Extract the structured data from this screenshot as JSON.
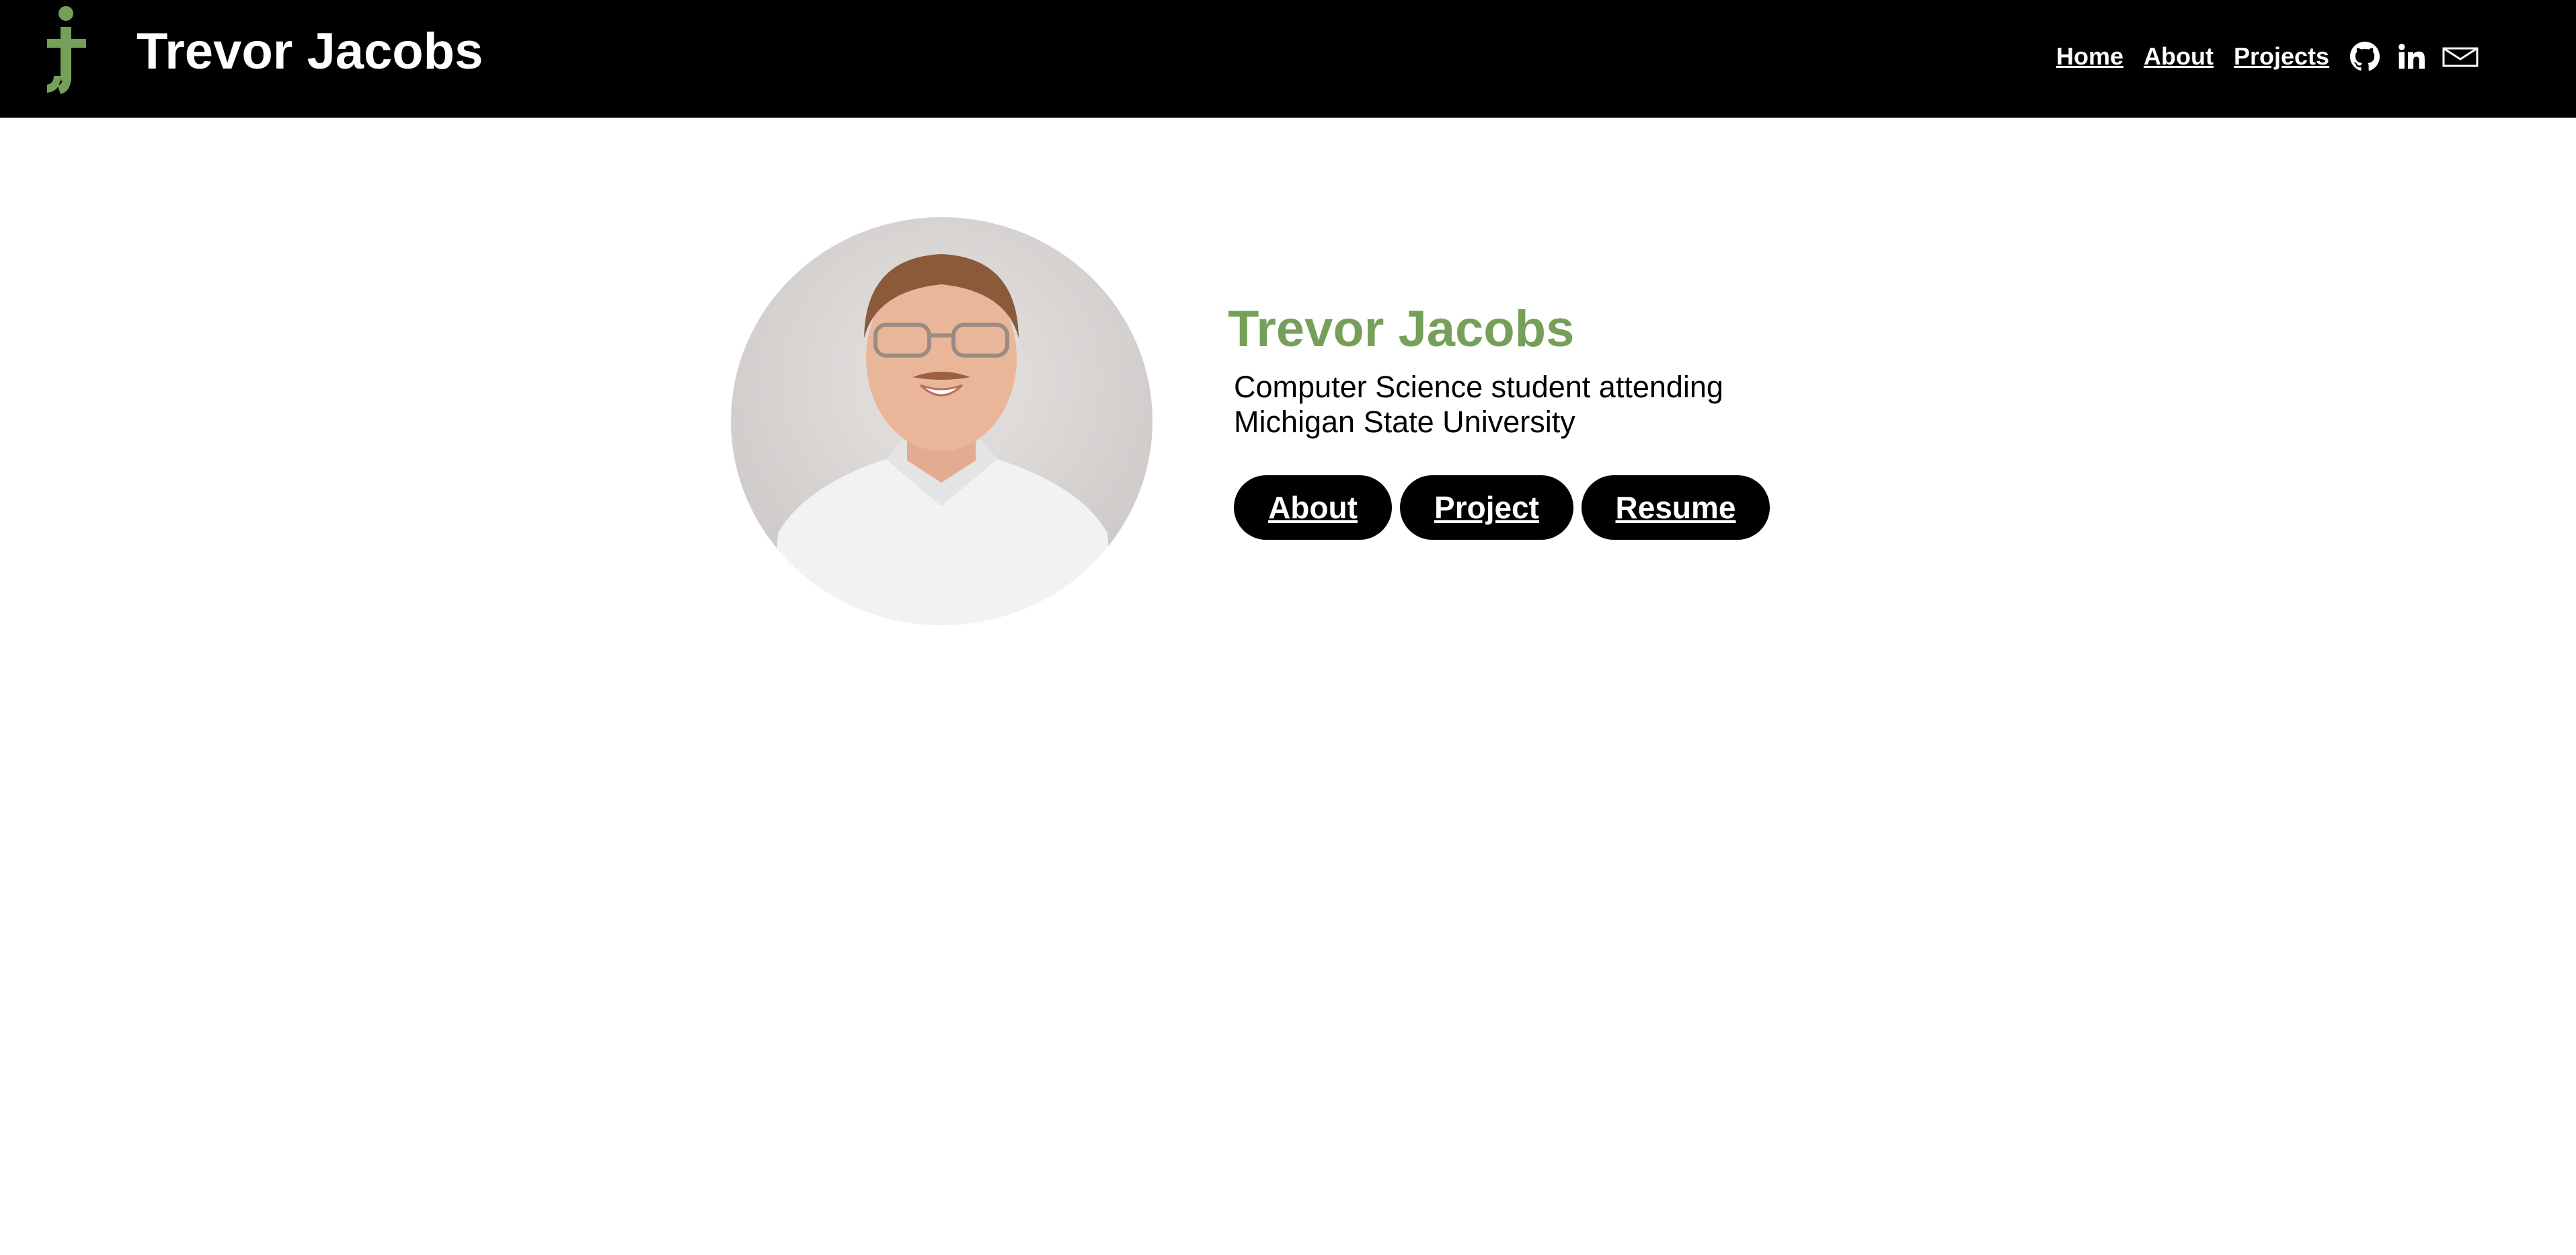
{
  "header": {
    "site_title": "Trevor Jacobs",
    "logo_icon": "tj-monogram-logo",
    "nav": {
      "home_label": "Home",
      "about_label": "About",
      "projects_label": "Projects"
    },
    "social_icons": [
      "github-icon",
      "linkedin-icon",
      "mail-icon"
    ]
  },
  "hero": {
    "name": "Trevor Jacobs",
    "description": "Computer Science student attending Michigan State University",
    "buttons": {
      "about_label": "About",
      "project_label": "Project",
      "resume_label": "Resume"
    }
  },
  "colors": {
    "accent": "#76a05a",
    "header_bg": "#000000",
    "button_bg": "#000000",
    "page_bg": "#ffffff"
  }
}
